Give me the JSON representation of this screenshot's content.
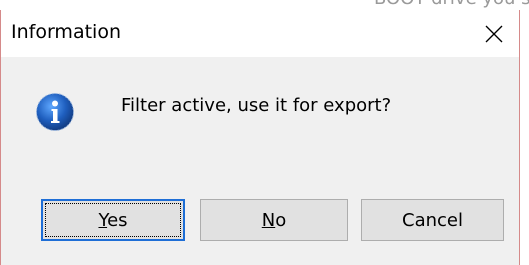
{
  "background": {
    "partial_text": "BOOT drive you s"
  },
  "dialog": {
    "title": "Information",
    "close_glyph": "✕",
    "icon": "information-icon",
    "message": "Filter active, use it for export?",
    "buttons": {
      "yes": {
        "mnemonic": "Y",
        "rest": "es"
      },
      "no": {
        "mnemonic": "N",
        "rest": "o"
      },
      "cancel": {
        "label": "Cancel"
      }
    },
    "default_button": "yes"
  },
  "colors": {
    "title_bg": "#ffffff",
    "body_bg": "#f0f0f0",
    "button_bg": "#e1e1e1",
    "button_border": "#adadad",
    "focus_border": "#1e6ed6",
    "info_icon_blue": "#1f5fbf"
  }
}
